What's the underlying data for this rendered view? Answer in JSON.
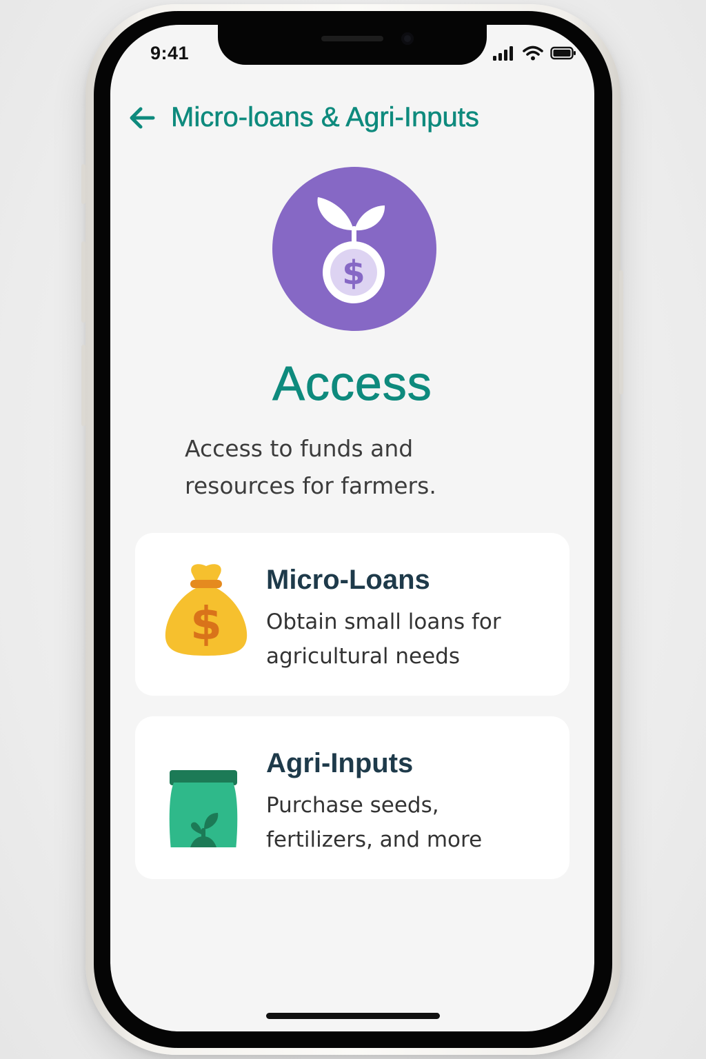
{
  "status_bar": {
    "time": "9:41",
    "icons": [
      "cellular-signal-icon",
      "wifi-icon",
      "battery-icon"
    ]
  },
  "header": {
    "back_icon": "arrow-left-icon",
    "title": "Micro-loans & Agri-Inputs"
  },
  "hero": {
    "icon": "sprout-dollar-icon",
    "title": "Access",
    "description": "Access to funds and resources for farmers."
  },
  "cards": [
    {
      "icon": "money-bag-icon",
      "title": "Micro-Loans",
      "description": "Obtain small loans for agricultural needs"
    },
    {
      "icon": "seed-bag-icon",
      "title": "Agri-Inputs",
      "description": "Purchase seeds, fertilizers, and more"
    }
  ],
  "colors": {
    "accent": "#0e8a7d",
    "hero_circle": "#8668c5",
    "money_bag": "#f6c02e",
    "seed_bag": "#2fb98a",
    "card_title": "#1e3a4a",
    "screen_background": "#f5f5f5"
  }
}
